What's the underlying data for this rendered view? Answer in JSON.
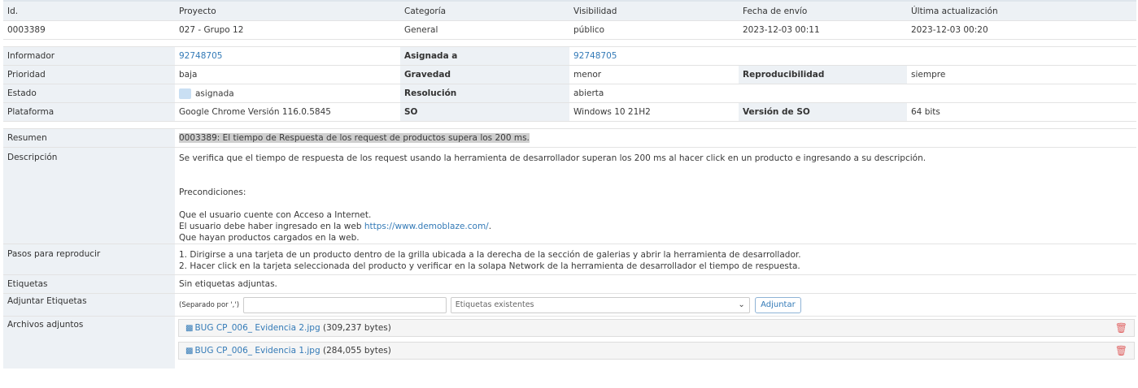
{
  "header": {
    "cols": [
      "Id.",
      "Proyecto",
      "Categoría",
      "Visibilidad",
      "Fecha de envío",
      "Última actualización"
    ],
    "values": [
      "0003389",
      "027 - Grupo 12",
      "General",
      "público",
      "2023-12-03 00:11",
      "2023-12-03 00:20"
    ]
  },
  "info": {
    "informador_label": "Informador",
    "informador_value": "92748705",
    "asignada_label": "Asignada a",
    "asignada_value": "92748705",
    "prioridad_label": "Prioridad",
    "prioridad_value": "baja",
    "gravedad_label": "Gravedad",
    "gravedad_value": "menor",
    "reproducibilidad_label": "Reproducibilidad",
    "reproducibilidad_value": "siempre",
    "estado_label": "Estado",
    "estado_value": "asignada",
    "resolucion_label": "Resolución",
    "resolucion_value": "abierta",
    "plataforma_label": "Plataforma",
    "plataforma_value": "Google Chrome Versión 116.0.5845",
    "so_label": "SO",
    "so_value": "Windows 10 21H2",
    "version_so_label": "Versión de SO",
    "version_so_value": "64 bits"
  },
  "details": {
    "resumen_label": "Resumen",
    "resumen_value": "0003389: El tiempo de Respuesta de los request de productos supera los 200 ms.",
    "descripcion_label": "Descripción",
    "descripcion_line1": "Se verifica que el tiempo de respuesta de los request usando la herramienta de desarrollador superan los 200 ms al hacer click en un producto e ingresando a su descripción.",
    "descripcion_pre": "Precondiciones:",
    "descripcion_l2": "Que el usuario cuente con Acceso a Internet.",
    "descripcion_l3_prefix": "El usuario debe haber ingresado en la web ",
    "descripcion_l3_link": "https://www.demoblaze.com/",
    "descripcion_l3_suffix": ".",
    "descripcion_l4": "Que hayan productos cargados en la web.",
    "pasos_label": "Pasos para reproducir",
    "pasos_l1": "1. Dirigirse a una tarjeta de un producto dentro de la grilla ubicada a la derecha de la sección de galerias y abrir la herramienta de desarrollador.",
    "pasos_l2": "2. Hacer click en la tarjeta seleccionada del producto y verificar en la solapa Network de la herramienta de desarrollador el tiempo de respuesta.",
    "etiquetas_label": "Etiquetas",
    "etiquetas_value": "Sin etiquetas adjuntas.",
    "adjuntar_label": "Adjuntar Etiquetas",
    "adjuntar_hint": "(Separado por ',')",
    "adjuntar_input": "",
    "etiquetas_select": "Etiquetas existentes",
    "adjuntar_button": "Adjuntar",
    "archivos_label": "Archivos adjuntos",
    "files": [
      {
        "name": "BUG CP_006_ Evidencia 2.jpg",
        "size": "(309,237 bytes)"
      },
      {
        "name": "BUG CP_006_ Evidencia 1.jpg",
        "size": "(284,055 bytes)"
      }
    ]
  }
}
